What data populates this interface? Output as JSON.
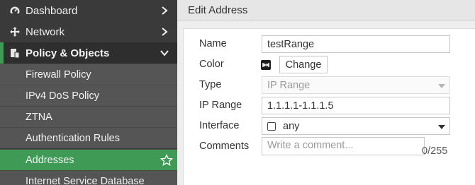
{
  "sidebar": {
    "items": [
      {
        "label": "Dashboard",
        "icon": "dashboard-icon"
      },
      {
        "label": "Network",
        "icon": "network-icon"
      },
      {
        "label": "Policy & Objects",
        "icon": "policy-objects-icon"
      },
      {
        "label": "Firewall Policy"
      },
      {
        "label": "IPv4 DoS Policy"
      },
      {
        "label": "ZTNA"
      },
      {
        "label": "Authentication Rules"
      },
      {
        "label": "Addresses"
      },
      {
        "label": "Internet Service Database"
      }
    ],
    "accent_color": "#3f9a55"
  },
  "main": {
    "title": "Edit Address",
    "form": {
      "name_label": "Name",
      "name_value": "testRange",
      "color_label": "Color",
      "color_swatch_icon": "color-swatch-icon",
      "change_button": "Change",
      "type_label": "Type",
      "type_value": "IP Range",
      "iprange_label": "IP Range",
      "iprange_value": "1.1.1.1-1.1.1.5",
      "interface_label": "Interface",
      "interface_value": "any",
      "comments_label": "Comments",
      "comments_placeholder": "Write a comment...",
      "comments_counter": "0/255"
    }
  }
}
